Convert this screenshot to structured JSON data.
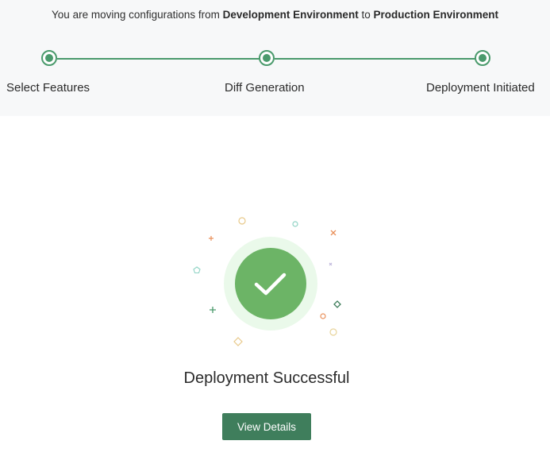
{
  "header": {
    "subtitle_prefix": "You are moving configurations from ",
    "source_env": "Development Environment",
    "subtitle_mid": " to ",
    "target_env": "Production Environment"
  },
  "stepper": {
    "steps": [
      {
        "label": "Select Features"
      },
      {
        "label": "Diff Generation"
      },
      {
        "label": "Deployment Initiated"
      }
    ],
    "color": "#4a9a6c"
  },
  "result": {
    "icon": "check-icon",
    "title": "Deployment Successful",
    "button_label": "View Details",
    "success_color": "#6cb466",
    "button_color": "#3f7e5c"
  }
}
